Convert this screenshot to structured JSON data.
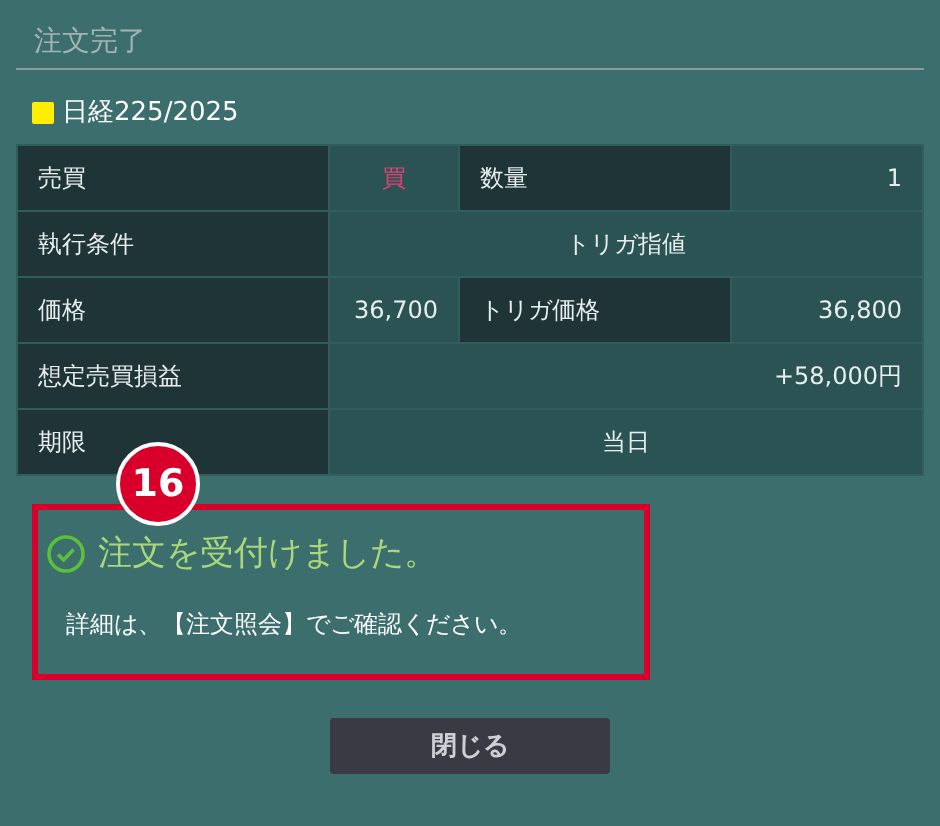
{
  "dialog": {
    "title": "注文完了"
  },
  "instrument": {
    "name": "日経225/2025"
  },
  "order_table": {
    "rows": [
      [
        {
          "kind": "label",
          "text": "売買"
        },
        {
          "kind": "buy",
          "text": "買"
        },
        {
          "kind": "label",
          "text": "数量"
        },
        {
          "kind": "value",
          "text": "1"
        }
      ],
      [
        {
          "kind": "label",
          "text": "執行条件"
        },
        {
          "kind": "wide-center",
          "text": "トリガ指値",
          "colspan": 3
        }
      ],
      [
        {
          "kind": "label",
          "text": "価格"
        },
        {
          "kind": "value",
          "text": "36,700"
        },
        {
          "kind": "label",
          "text": "トリガ価格"
        },
        {
          "kind": "value",
          "text": "36,800"
        }
      ],
      [
        {
          "kind": "label",
          "text": "想定売買損益"
        },
        {
          "kind": "wide-right",
          "text": "+58,000円",
          "colspan": 3
        }
      ],
      [
        {
          "kind": "label",
          "text": "期限"
        },
        {
          "kind": "wide-center",
          "text": "当日",
          "colspan": 3
        }
      ]
    ]
  },
  "message": {
    "kind": "success",
    "headline": "注文を受付けました。",
    "detail": "詳細は、【注文照会】でご確認ください。"
  },
  "annotation": {
    "number": "16"
  },
  "buttons": [
    {
      "label": "閉じる"
    }
  ]
}
